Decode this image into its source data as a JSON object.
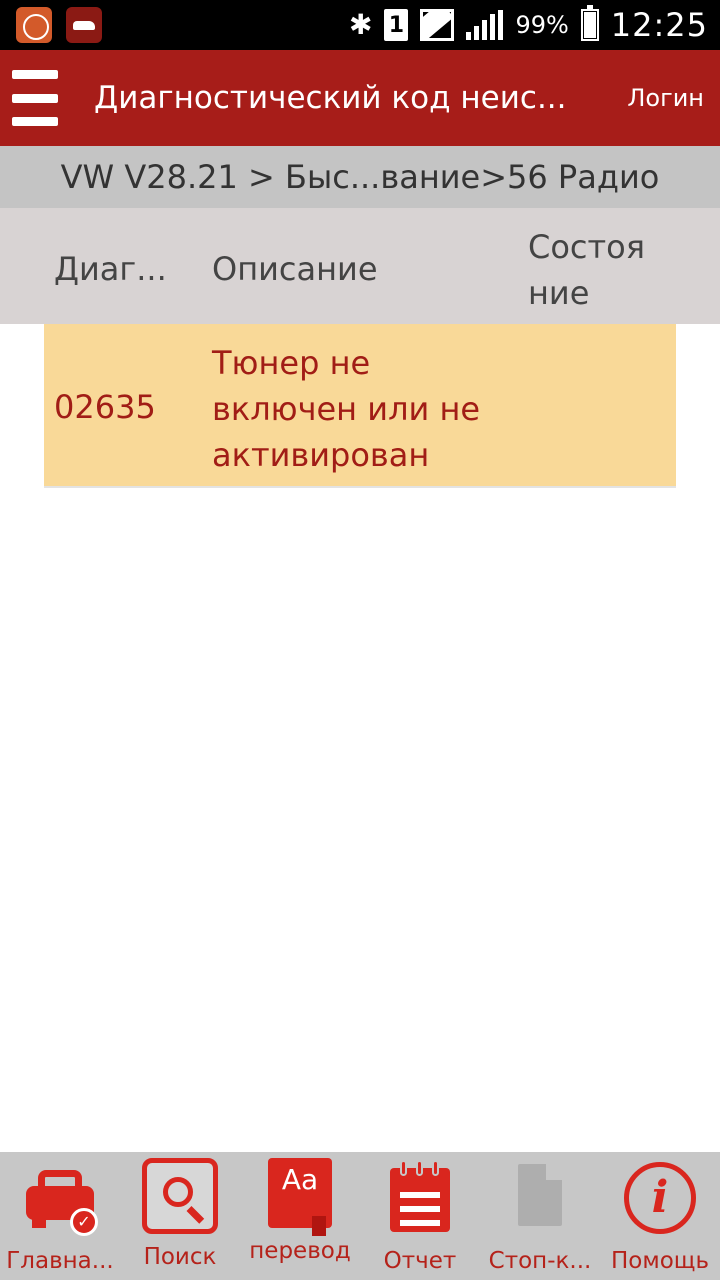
{
  "status_bar": {
    "battery_percent": "99%",
    "time": "12:25",
    "sim_label": "1",
    "bluetooth_glyph": "✱"
  },
  "app_bar": {
    "title": "Диагностический код неис...",
    "login": "Логин"
  },
  "breadcrumb": "VW V28.21 > Быс...вание>56 Радио",
  "table": {
    "headers": {
      "code": "Диаг...",
      "description": "Описание",
      "state": "Состоя ние"
    },
    "rows": [
      {
        "code": "02635",
        "description": "Тюнер не включен или не активирован",
        "state": ""
      }
    ]
  },
  "bottom_nav": {
    "items": [
      {
        "label": "Главна...",
        "icon": "car-check-icon",
        "enabled": true
      },
      {
        "label": "Поиск",
        "icon": "search-icon",
        "enabled": true
      },
      {
        "label": "перевод",
        "icon": "translate-icon",
        "enabled": true
      },
      {
        "label": "Отчет",
        "icon": "report-icon",
        "enabled": true
      },
      {
        "label": "Стоп-к...",
        "icon": "file-icon",
        "enabled": false
      },
      {
        "label": "Помощь",
        "icon": "help-icon",
        "enabled": true
      }
    ],
    "translate_glyph": "Aa",
    "help_glyph": "i",
    "check_glyph": "✓"
  },
  "colors": {
    "app_bar": "#a71d19",
    "accent": "#d9261e",
    "row_highlight": "#f9d998",
    "row_text": "#a11d16",
    "breadcrumb_bg": "#c4c4c4",
    "header_bg": "#d8d3d3",
    "nav_bg": "#c7c7c7"
  }
}
